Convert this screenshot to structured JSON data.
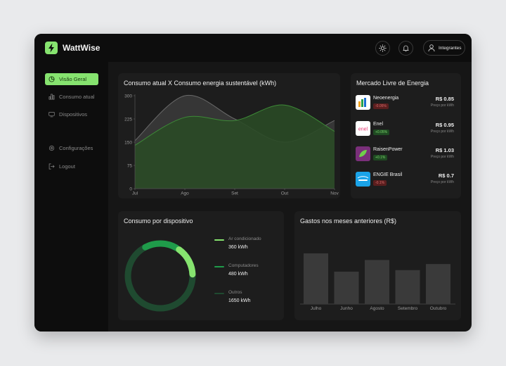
{
  "app": {
    "name": "WattWise",
    "user_label": "Integrantes"
  },
  "icons": {
    "logo": "lightning-icon",
    "theme": "sun-icon",
    "notifications": "bell-icon",
    "user": "user-icon"
  },
  "sidebar": {
    "items": [
      {
        "label": "Visão Geral",
        "icon": "pie-chart-icon",
        "active": true
      },
      {
        "label": "Consumo atual",
        "icon": "bar-chart-icon",
        "active": false
      },
      {
        "label": "Dispositivos",
        "icon": "monitor-icon",
        "active": false
      },
      {
        "label": "Configurações",
        "icon": "gear-icon",
        "active": false
      },
      {
        "label": "Logout",
        "icon": "logout-icon",
        "active": false
      }
    ]
  },
  "colors": {
    "accent": "#86e36f",
    "bg": "#161616",
    "card": "#1d1d1d"
  },
  "area_chart": {
    "title": "Consumo atual X Consumo energia sustentável (kWh)",
    "chart_data": {
      "type": "area",
      "categories": [
        "Jul",
        "Ago",
        "Set",
        "Out",
        "Nov"
      ],
      "yticks": [
        0,
        75,
        150,
        225,
        300
      ],
      "ylim": [
        0,
        300
      ],
      "series": [
        {
          "values": [
            155,
            300,
            225,
            150,
            220
          ],
          "color": "#4a4a4a"
        },
        {
          "values": [
            140,
            230,
            220,
            270,
            185
          ],
          "color": "#2f6a2a"
        }
      ]
    }
  },
  "market": {
    "title": "Mercado Livre de Energia",
    "items": [
      {
        "name": "Neoenergia",
        "change": "-0.05%",
        "direction": "down",
        "price": "R$ 0.85",
        "unit": "Preço por kWh",
        "logo_color": "#ffffff"
      },
      {
        "name": "Enel",
        "change": "+0.05%",
        "direction": "up",
        "price": "R$ 0.95",
        "unit": "Preço por kWh",
        "logo_color": "#ffffff"
      },
      {
        "name": "RaisenPower",
        "change": "+0.1%",
        "direction": "up",
        "price": "R$ 1.03",
        "unit": "Preço por kWh",
        "logo_color": "#7a2f7a"
      },
      {
        "name": "ENGIE Brasil",
        "change": "-0.1%",
        "direction": "down",
        "price": "R$ 0.7",
        "unit": "Preço por kWh",
        "logo_color": "#1aa3e8"
      }
    ]
  },
  "devices": {
    "title": "Consumo por dispositivo",
    "chart_data": {
      "type": "pie",
      "labels": [
        "Ar condicionado",
        "Computadores",
        "Outros"
      ],
      "value_labels": [
        "360 kWh",
        "480 kWh",
        "1650 kWh"
      ],
      "values": [
        360,
        480,
        1650
      ],
      "colors": [
        "#86e36f",
        "#1f9b4a",
        "#1f4a30"
      ]
    }
  },
  "expenses": {
    "title": "Gastos nos meses anteriores (R$)",
    "chart_data": {
      "type": "bar",
      "categories": [
        "Julho",
        "Junho",
        "Agosto",
        "Setembro",
        "Outubro"
      ],
      "values": [
        100,
        64,
        87,
        67,
        79
      ],
      "ylim": [
        0,
        100
      ]
    }
  }
}
